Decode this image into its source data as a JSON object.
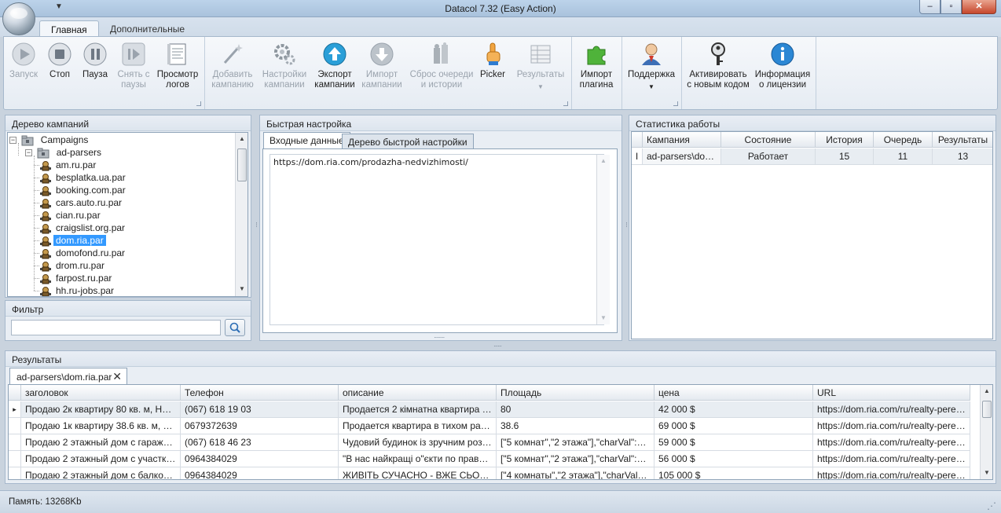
{
  "window": {
    "title": "Datacol 7.32 (Easy Action)",
    "qa_arrow": "▼",
    "min": "–",
    "max": "▫",
    "close": "✕"
  },
  "ribbon_tabs": [
    "Главная",
    "Дополнительные"
  ],
  "ribbon": {
    "start": "Запуск",
    "stop": "Стоп",
    "pause": "Пауза",
    "unpause_1": "Снять с",
    "unpause_2": "паузы",
    "logs_1": "Просмотр",
    "logs_2": "логов",
    "add_campaign_1": "Добавить",
    "add_campaign_2": "кампанию",
    "campaign_settings_1": "Настройки",
    "campaign_settings_2": "кампании",
    "export_1": "Экспорт",
    "export_2": "кампании",
    "import_1": "Импорт",
    "import_2": "кампании",
    "reset_1": "Сброс очереди",
    "reset_2": "и истории",
    "picker": "Picker",
    "results": "Результаты",
    "import_plugin_1": "Импорт",
    "import_plugin_2": "плагина",
    "support": "Поддержка",
    "activate_1": "Активировать",
    "activate_2": "с новым кодом",
    "license_1": "Информация",
    "license_2": "о лицензии"
  },
  "campaign_tree": {
    "header": "Дерево кампаний",
    "root": "Campaigns",
    "folder": "ad-parsers",
    "items": [
      "am.ru.par",
      "besplatka.ua.par",
      "booking.com.par",
      "cars.auto.ru.par",
      "cian.ru.par",
      "craigslist.org.par",
      "dom.ria.par",
      "domofond.ru.par",
      "drom.ru.par",
      "farpost.ru.par",
      "hh.ru-jobs.par"
    ],
    "selected_index": 6
  },
  "filter": {
    "header": "Фильтр",
    "value": ""
  },
  "quick_settings": {
    "header": "Быстрая настройка",
    "tabs": [
      "Входные данные",
      "Дерево быстрой настройки"
    ],
    "input_text": "https://dom.ria.com/prodazha-nedvizhimosti/"
  },
  "stats": {
    "header": "Статистика работы",
    "columns": [
      "Кампания",
      "Состояние",
      "История",
      "Очередь",
      "Результаты"
    ],
    "row": [
      "ad-parsers\\dom...",
      "Работает",
      "15",
      "11",
      "13"
    ],
    "row_marker": "I"
  },
  "results": {
    "header": "Результаты",
    "tab": "ad-parsers\\dom.ria.par",
    "tab_close": "✕",
    "columns": [
      "заголовок",
      "Телефон",
      "описание",
      "Площадь",
      "цена",
      "URL"
    ],
    "rows": [
      [
        "Продаю 2к квартиру 80 кв. м, Наро...",
        "(067) 618 19 03",
        "Продается 2 кімнатна квартира в ...",
        "80",
        "42 000 $",
        "https://dom.ria.com/ru/realty-perevir..."
      ],
      [
        "Продаю 1к квартиру 38.6 кв. м, Ак...",
        "0679372639",
        "Продается квартира в тихом район...",
        "38.6",
        "69 000 $",
        "https://dom.ria.com/ru/realty-perevir..."
      ],
      [
        "Продаю 2 этажный дом с гаражом и...",
        "(067) 618 46 23",
        "Чудовий будинок із зручним розташ...",
        "[\"5 комнат\",\"2 этажа\"],\"charVal\":5,\"g...",
        "59 000 $",
        "https://dom.ria.com/ru/realty-perevir..."
      ],
      [
        "Продаю 2 этажный дом с участком ...",
        "0964384029",
        "\"В нас найкращі о\"єкти по правильн...",
        "[\"5 комнат\",\"2 этажа\"],\"charVal\":5,\"g...",
        "56 000 $",
        "https://dom.ria.com/ru/realty-perevir..."
      ],
      [
        "Продаю 2 этажный дом с балконом ...",
        "0964384029",
        "ЖИВІТЬ СУЧАСНО - ВЖЕ СЬОГОДНІ...",
        "[\"4 комнаты\",\"2 этажа\"],\"charVal\":4....",
        "105 000 $",
        "https://dom.ria.com/ru/realty-perevir..."
      ]
    ],
    "row_marker": "▸"
  },
  "status": {
    "memory": "Память: 13268Kb"
  },
  "colors": {
    "selection": "#3399ff",
    "ribbon_bg": "#e6ecf3",
    "frame": "#c9d3de"
  }
}
